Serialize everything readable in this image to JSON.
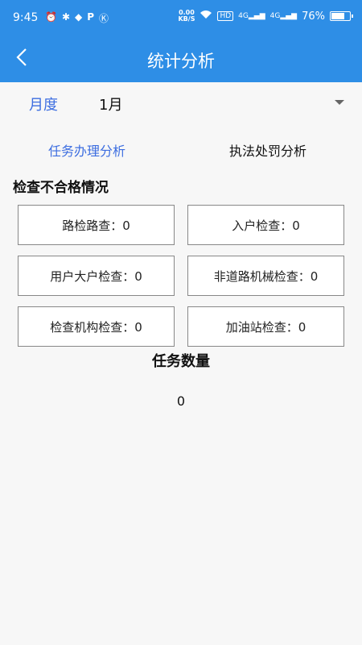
{
  "status_bar": {
    "time": "9:45",
    "left_icons": [
      "alarm-icon",
      "bluetooth-icon",
      "shield-icon",
      "parking-app-icon",
      "k-app-icon"
    ],
    "speed_value": "0.00",
    "speed_unit": "KB/S",
    "hd_label": "HD",
    "signal_1": "4G",
    "signal_2": "4G",
    "battery_text": "76%",
    "battery_level": 0.76
  },
  "nav": {
    "title": "统计分析",
    "back_icon": "chevron-left-icon"
  },
  "month_selector": {
    "label": "月度",
    "value": "1月"
  },
  "tabs": [
    {
      "label": "任务办理分析",
      "active": true
    },
    {
      "label": "执法处罚分析",
      "active": false
    }
  ],
  "inspection": {
    "title": "检查不合格情况",
    "cards": [
      {
        "text": "路检路查：0"
      },
      {
        "text": "入户检查：0"
      },
      {
        "text": "用户大户检查：0"
      },
      {
        "text": "非道路机械检查：0"
      },
      {
        "text": "检查机构检查：0"
      },
      {
        "text": "加油站检查：0"
      }
    ]
  },
  "task": {
    "title": "任务数量",
    "count": "0"
  },
  "colors": {
    "primary": "#2e8ee6",
    "accent_text": "#3d6ee0",
    "background": "#f7f7f7"
  }
}
